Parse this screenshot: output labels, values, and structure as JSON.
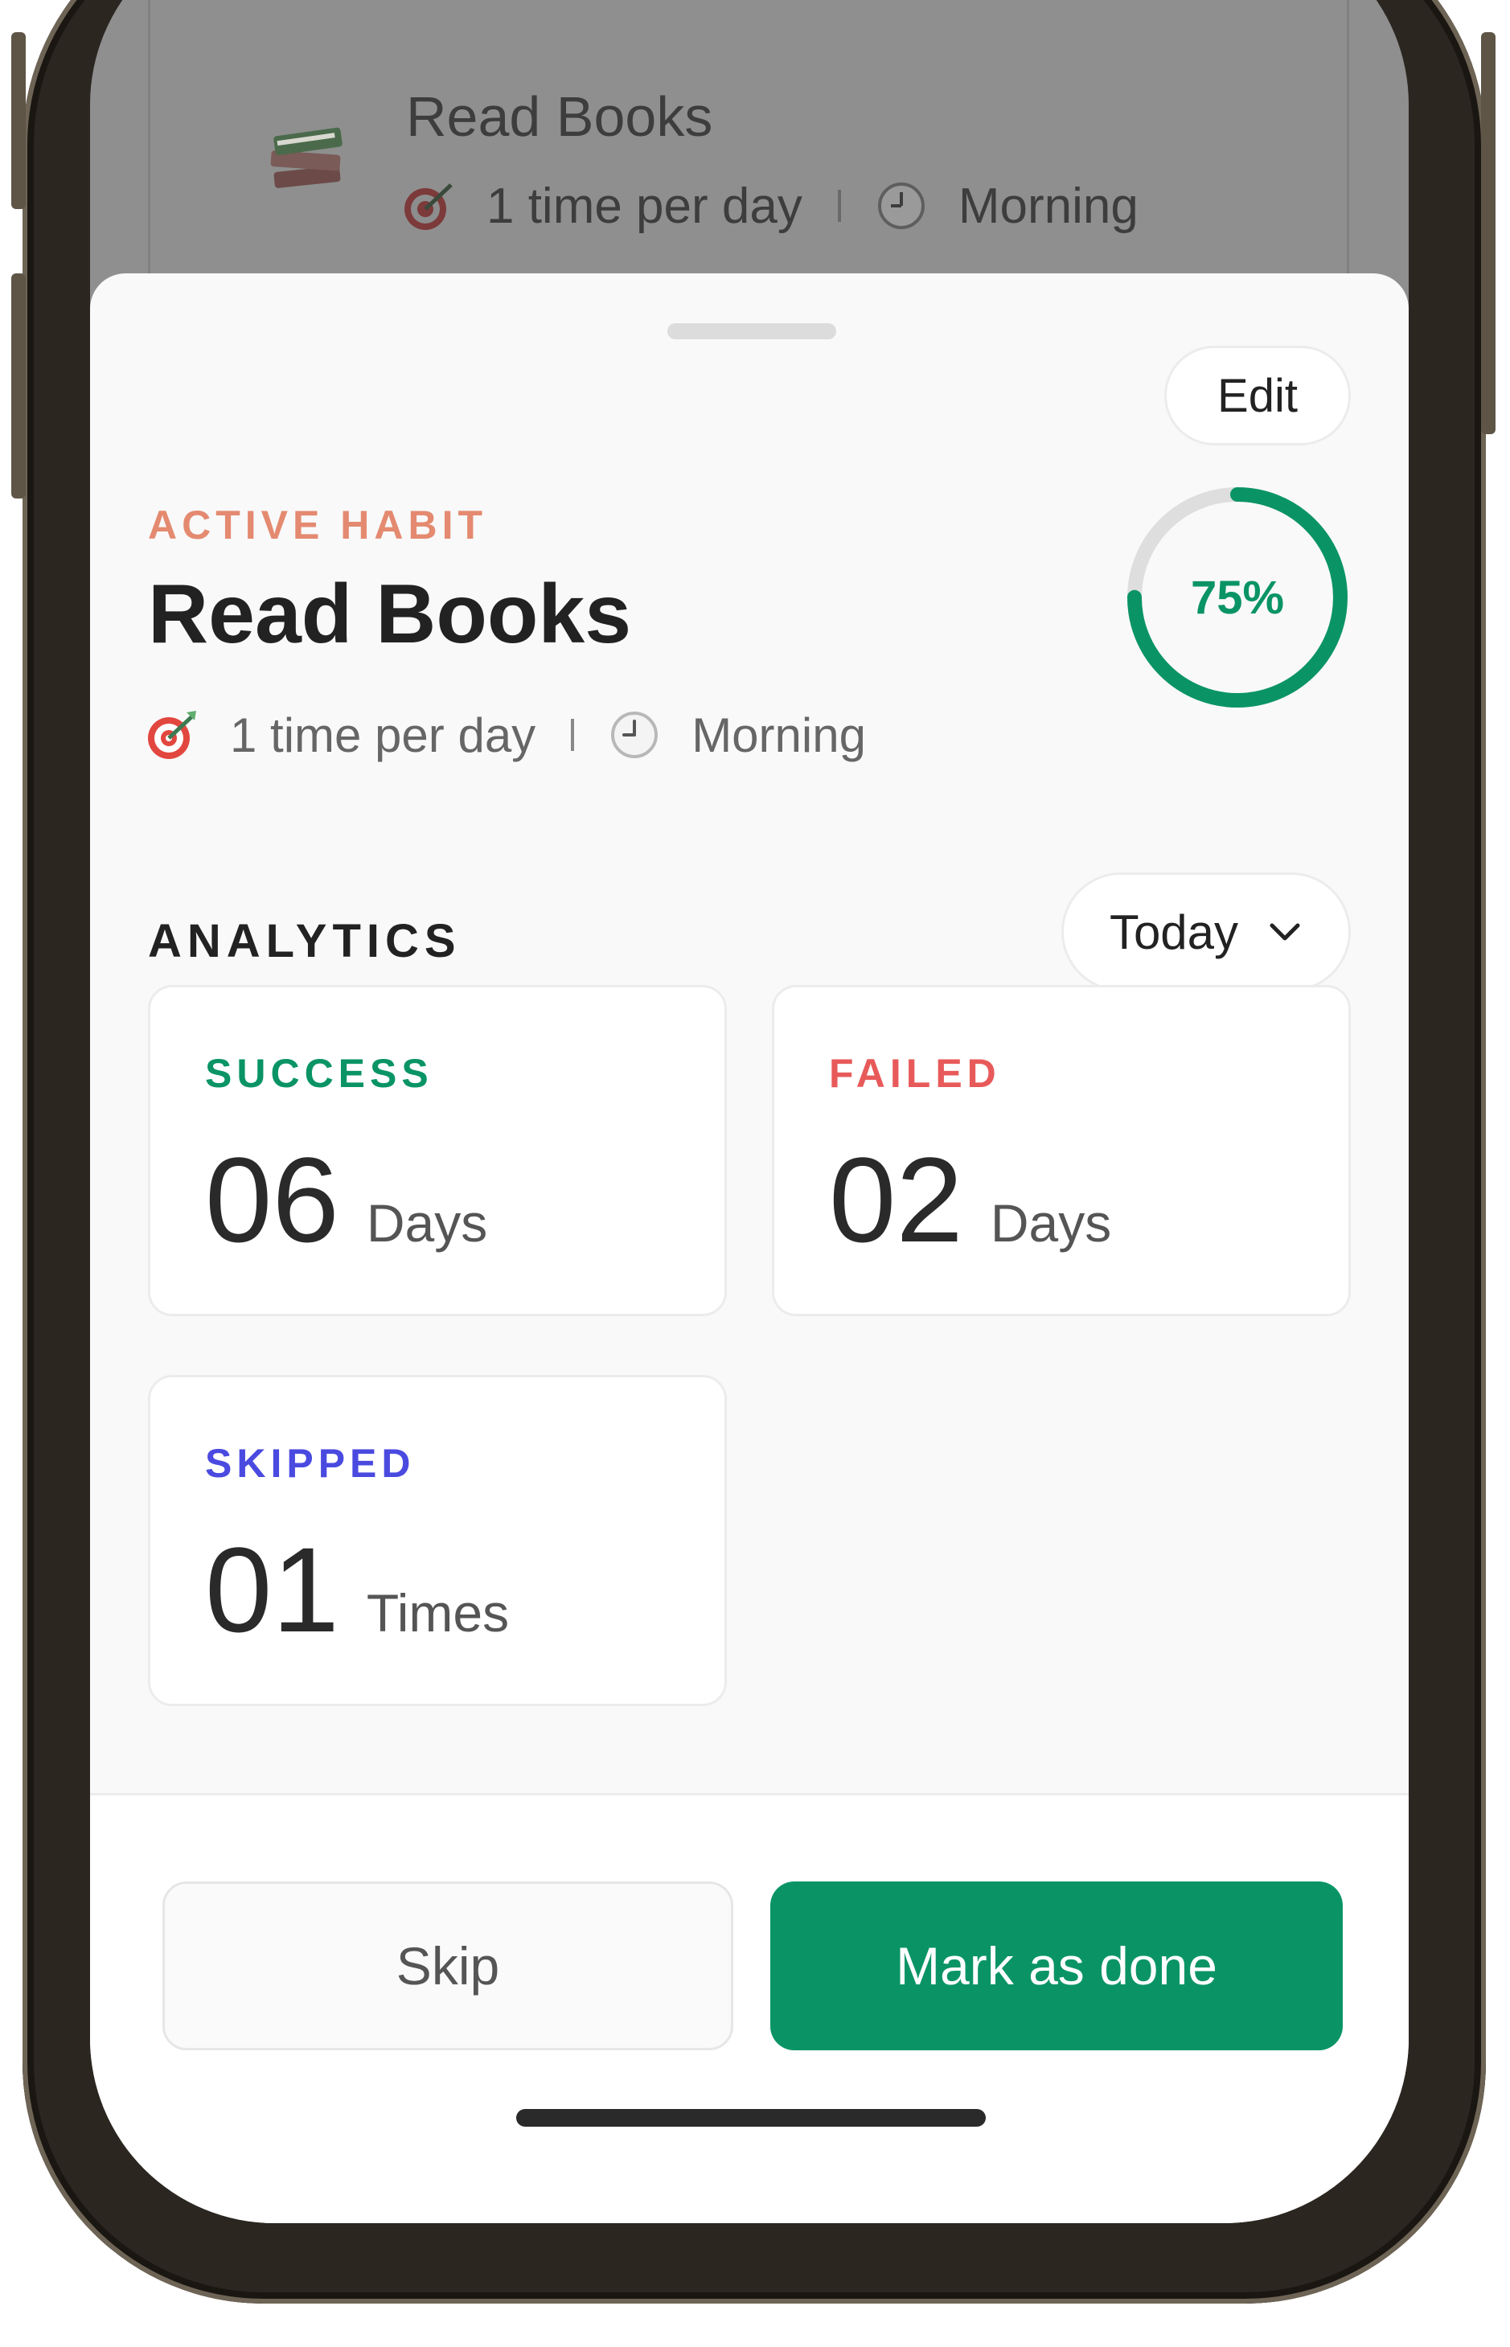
{
  "background_card": {
    "title": "Read Books",
    "frequency": "1 time per day",
    "time_of_day": "Morning"
  },
  "sheet": {
    "edit_label": "Edit",
    "eyebrow": "ACTIVE HABIT",
    "title": "Read Books",
    "frequency": "1 time per day",
    "time_of_day": "Morning",
    "progress": {
      "value": 0.75,
      "label": "75%"
    },
    "analytics": {
      "title": "ANALYTICS",
      "range_selected": "Today",
      "stats": [
        {
          "label": "SUCCESS",
          "value": "06",
          "unit": "Days",
          "color": "#0a9466"
        },
        {
          "label": "FAILED",
          "value": "02",
          "unit": "Days",
          "color": "#e85a5a"
        },
        {
          "label": "SKIPPED",
          "value": "01",
          "unit": "Times",
          "color": "#4a4ae0"
        }
      ]
    },
    "actions": {
      "skip_label": "Skip",
      "done_label": "Mark as done"
    }
  },
  "icons": {
    "book": "books-icon",
    "target": "target-icon",
    "clock": "clock-icon",
    "chevron": "chevron-down-icon"
  },
  "colors": {
    "accent": "#0a9466",
    "eyebrow": "#e48a70",
    "progress_track": "#dedede"
  }
}
